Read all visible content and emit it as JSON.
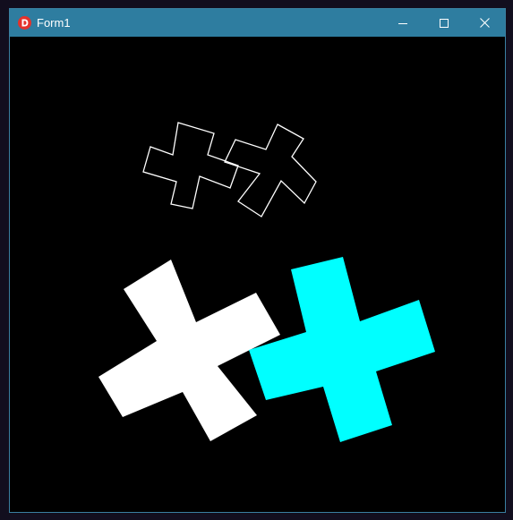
{
  "window": {
    "title": "Form1",
    "app_icon": "delphi-icon",
    "controls": {
      "minimize": "minimize-icon",
      "maximize": "maximize-icon",
      "close": "close-icon"
    }
  },
  "canvas": {
    "background": "#000000",
    "shapes": [
      {
        "name": "outline-cross-left",
        "style": "outline",
        "color": "#ffffff"
      },
      {
        "name": "outline-cross-right",
        "style": "outline",
        "color": "#ffffff"
      },
      {
        "name": "filled-cross-white",
        "style": "filled",
        "color": "#ffffff"
      },
      {
        "name": "filled-cross-cyan",
        "style": "filled",
        "color": "#00ffff"
      }
    ]
  },
  "colors": {
    "titlebar": "#2e7da0",
    "window_border": "#3a7fa0",
    "desktop": "#120e1e"
  }
}
